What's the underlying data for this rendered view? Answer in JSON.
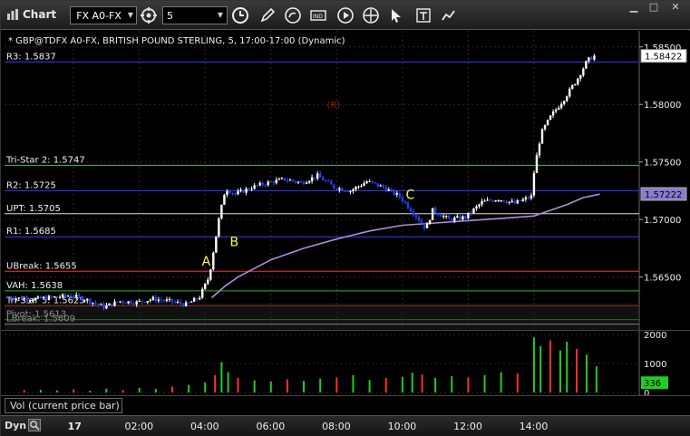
{
  "window": {
    "title": "Chart"
  },
  "toolbar": {
    "symbol": " FX A0-FX",
    "period": "5",
    "icons": [
      "chain-link-icon",
      "clock-icon",
      "pencil-icon",
      "refresh-icon",
      "indicator-icon",
      "play-icon",
      "crosshair-icon",
      "cursor-icon",
      "text-icon",
      "chart-settings-icon"
    ]
  },
  "chart_data": {
    "type": "candlestick",
    "title": "* GBP@TDFX A0-FX, BRITISH POUND STERLING, 5, 17:00-17:00 (Dynamic)",
    "y_ticks": [
      "1.58500",
      "1.58000",
      "1.57500",
      "1.57000",
      "1.56500"
    ],
    "y_tick_values": [
      1.585,
      1.58,
      1.575,
      1.57,
      1.565
    ],
    "ylim": [
      1.5604,
      1.5864
    ],
    "last_price": "1.58422",
    "last_price_value": 1.58422,
    "ma_value_label": "1.57222",
    "ma_value": 1.57222,
    "x_ticks": [
      "17",
      "02:00",
      "04:00",
      "06:00",
      "08:00",
      "10:00",
      "12:00",
      "14:00"
    ],
    "x_tick_hours": [
      0,
      2,
      4,
      6,
      8,
      10,
      12,
      14
    ],
    "xlim_hours": [
      -2.1,
      17.2
    ],
    "levels": [
      {
        "label": "R3: 1.5837",
        "value": 1.5837,
        "color": "#3a3aff"
      },
      {
        "label": "Tri-Star 2: 1.5747",
        "value": 1.5747,
        "color": "#22bb22"
      },
      {
        "label": "R2: 1.5725",
        "value": 1.5725,
        "color": "#3a3aff"
      },
      {
        "label": "UPT: 1.5705",
        "value": 1.5705,
        "color": "#dddddd"
      },
      {
        "label": "R1: 1.5685",
        "value": 1.5685,
        "color": "#3a3aff"
      },
      {
        "label": "UBreak: 1.5655",
        "value": 1.5655,
        "color": "#ff3030"
      },
      {
        "label": "VAH: 1.5638",
        "value": 1.5638,
        "color": "#22bb22"
      },
      {
        "label": "Tri-Star 3: 1.5625",
        "value": 1.5625,
        "color": "#ff3030"
      },
      {
        "label": "Pivot: 1.5613",
        "value": 1.5613,
        "color": "#22bb22"
      },
      {
        "label": "LBreak: 1.5609",
        "value": 1.5609,
        "color": "#dddddd"
      }
    ],
    "annotations": [
      {
        "text": "A",
        "x": 3.9,
        "y": 1.566,
        "color": "#ffff33"
      },
      {
        "text": "B",
        "x": 4.75,
        "y": 1.5677,
        "color": "#ffff33"
      },
      {
        "text": "C",
        "x": 10.1,
        "y": 1.5718,
        "color": "#ffff33"
      },
      {
        "text": "(R)",
        "x": 7.7,
        "y": 1.5797,
        "color": "#aa1111"
      }
    ],
    "price_path": [
      [
        -2.0,
        1.5632
      ],
      [
        -1.0,
        1.5631
      ],
      [
        0.0,
        1.5634
      ],
      [
        0.5,
        1.563
      ],
      [
        1.0,
        1.5624
      ],
      [
        1.5,
        1.5629
      ],
      [
        2.0,
        1.5628
      ],
      [
        2.5,
        1.5631
      ],
      [
        3.0,
        1.5629
      ],
      [
        3.5,
        1.5626
      ],
      [
        3.9,
        1.5632
      ],
      [
        4.2,
        1.565
      ],
      [
        4.5,
        1.57
      ],
      [
        4.7,
        1.5727
      ],
      [
        5.0,
        1.5722
      ],
      [
        5.5,
        1.5728
      ],
      [
        6.0,
        1.5732
      ],
      [
        6.5,
        1.5735
      ],
      [
        7.0,
        1.5732
      ],
      [
        7.5,
        1.5738
      ],
      [
        8.0,
        1.5728
      ],
      [
        8.5,
        1.5725
      ],
      [
        9.0,
        1.5733
      ],
      [
        9.5,
        1.5728
      ],
      [
        10.0,
        1.572
      ],
      [
        10.5,
        1.5703
      ],
      [
        10.8,
        1.5692
      ],
      [
        11.0,
        1.5708
      ],
      [
        11.5,
        1.57
      ],
      [
        12.0,
        1.5702
      ],
      [
        12.5,
        1.5715
      ],
      [
        13.0,
        1.5718
      ],
      [
        13.5,
        1.5714
      ],
      [
        14.0,
        1.572
      ],
      [
        14.1,
        1.5745
      ],
      [
        14.3,
        1.5775
      ],
      [
        14.6,
        1.579
      ],
      [
        15.0,
        1.5805
      ],
      [
        15.4,
        1.5822
      ],
      [
        15.7,
        1.5838
      ],
      [
        15.9,
        1.5842
      ]
    ],
    "ma_path": [
      [
        4.2,
        1.5632
      ],
      [
        4.6,
        1.5642
      ],
      [
        5.0,
        1.565
      ],
      [
        6.0,
        1.5665
      ],
      [
        7.0,
        1.5675
      ],
      [
        8.0,
        1.5683
      ],
      [
        9.0,
        1.569
      ],
      [
        10.0,
        1.5695
      ],
      [
        11.0,
        1.5697
      ],
      [
        12.0,
        1.5699
      ],
      [
        13.0,
        1.5701
      ],
      [
        14.0,
        1.5703
      ],
      [
        14.5,
        1.5708
      ],
      [
        15.0,
        1.5713
      ],
      [
        15.5,
        1.5719
      ],
      [
        16.0,
        1.5722
      ]
    ],
    "volume": {
      "label": "Vol (current price bar)",
      "y_ticks": [
        "2000",
        "1000",
        "0"
      ],
      "y_tick_values": [
        2000,
        1000,
        0
      ],
      "ylim": [
        0,
        2000
      ],
      "last_value": "336",
      "last_value_num": 336,
      "bars": [
        [
          -1.5,
          80
        ],
        [
          -1.0,
          90
        ],
        [
          -0.5,
          70
        ],
        [
          0.0,
          110
        ],
        [
          0.5,
          60
        ],
        [
          1.0,
          130
        ],
        [
          1.5,
          90
        ],
        [
          2.0,
          160
        ],
        [
          2.5,
          120
        ],
        [
          3.0,
          200
        ],
        [
          3.5,
          260
        ],
        [
          4.0,
          350
        ],
        [
          4.3,
          600
        ],
        [
          4.5,
          1050
        ],
        [
          4.7,
          700
        ],
        [
          5.0,
          500
        ],
        [
          5.5,
          420
        ],
        [
          6.0,
          380
        ],
        [
          6.5,
          450
        ],
        [
          7.0,
          400
        ],
        [
          7.5,
          480
        ],
        [
          8.0,
          520
        ],
        [
          8.5,
          600
        ],
        [
          9.0,
          430
        ],
        [
          9.5,
          500
        ],
        [
          10.0,
          540
        ],
        [
          10.3,
          680
        ],
        [
          10.6,
          620
        ],
        [
          11.0,
          500
        ],
        [
          11.5,
          560
        ],
        [
          12.0,
          520
        ],
        [
          12.5,
          600
        ],
        [
          13.0,
          700
        ],
        [
          13.5,
          650
        ],
        [
          14.0,
          1900
        ],
        [
          14.2,
          1600
        ],
        [
          14.5,
          1800
        ],
        [
          14.8,
          1450
        ],
        [
          15.0,
          1750
        ],
        [
          15.3,
          1500
        ],
        [
          15.6,
          1300
        ],
        [
          15.9,
          900
        ]
      ]
    }
  },
  "bottom": {
    "dyn": "Dyn"
  }
}
